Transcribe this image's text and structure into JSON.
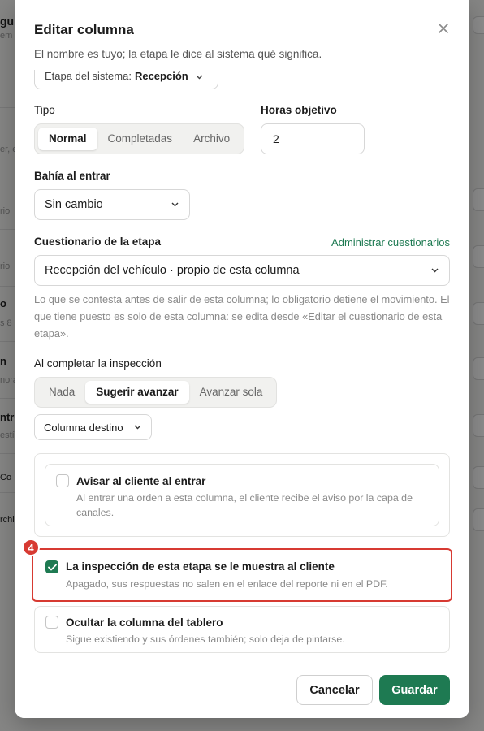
{
  "background": {
    "fragments": [
      "gu",
      "em",
      "er, e",
      "rio",
      "rio",
      "o",
      "s 8",
      "n",
      "nora",
      "ntre",
      "estí",
      "Co",
      "rchi"
    ]
  },
  "modal": {
    "title": "Editar columna",
    "subtitle": "El nombre es tuyo; la etapa le dice al sistema qué significa.",
    "stage_label": "Etapa del sistema:",
    "stage_value": "Recepción",
    "tipo": {
      "label": "Tipo",
      "options": [
        "Normal",
        "Completadas",
        "Archivo"
      ],
      "selected": "Normal"
    },
    "horas": {
      "label": "Horas objetivo",
      "value": "2"
    },
    "bahia": {
      "label": "Bahía al entrar",
      "value": "Sin cambio"
    },
    "cuestionario": {
      "label": "Cuestionario de la etapa",
      "manage_link": "Administrar cuestionarios",
      "value": "Recepción del vehículo · propio de esta columna",
      "help": "Lo que se contesta antes de salir de esta columna; lo obligatorio detiene el movimiento. El que tiene puesto es solo de esta columna: se edita desde «Editar el cuestionario de esta etapa»."
    },
    "inspeccion": {
      "label": "Al completar la inspección",
      "options": [
        "Nada",
        "Sugerir avanzar",
        "Avanzar sola"
      ],
      "selected": "Sugerir avanzar",
      "destino_label": "Columna destino"
    },
    "options": [
      {
        "title": "Avisar al cliente al entrar",
        "desc": "Al entrar una orden a esta columna, el cliente recibe el aviso por la capa de canales.",
        "checked": false
      },
      {
        "title": "La inspección de esta etapa se le muestra al cliente",
        "desc": "Apagado, sus respuestas no salen en el enlace del reporte ni en el PDF.",
        "checked": true
      },
      {
        "title": "Ocultar la columna del tablero",
        "desc": "Sigue existiendo y sus órdenes también; solo deja de pintarse.",
        "checked": false
      }
    ],
    "step_badge": "4",
    "cancel_label": "Cancelar",
    "save_label": "Guardar"
  },
  "colors": {
    "accent": "#1e7a52",
    "highlight": "#d73a32"
  }
}
